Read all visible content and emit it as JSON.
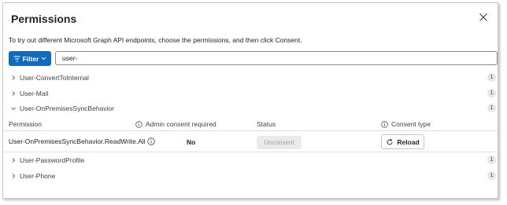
{
  "dialog": {
    "title": "Permissions",
    "subtitle": "To try out different Microsoft Graph API endpoints, choose the permissions, and then click Consent."
  },
  "filter": {
    "label": "Filter"
  },
  "search": {
    "value": "user-"
  },
  "groups": [
    {
      "name": "User-ConvertToInternal",
      "count": "1",
      "expanded": false
    },
    {
      "name": "User-Mail",
      "count": "1",
      "expanded": false
    },
    {
      "name": "User-OnPremisesSyncBehavior",
      "count": "1",
      "expanded": true
    },
    {
      "name": "User-PasswordProfile",
      "count": "1",
      "expanded": false
    },
    {
      "name": "User-Phone",
      "count": "1",
      "expanded": false
    }
  ],
  "table": {
    "headers": {
      "permission": "Permission",
      "admin_consent": "Admin consent required",
      "status": "Status",
      "consent_type": "Consent type"
    },
    "row": {
      "permission": "User-OnPremisesSyncBehavior.ReadWrite.All",
      "admin_consent": "No",
      "status_button": "Unconsent",
      "consent_button": "Reload"
    }
  },
  "colors": {
    "accent": "#0f6cbd",
    "disabled_bg": "#eaeaea"
  },
  "icons": {
    "close": "close-icon",
    "filter": "filter-lines-icon",
    "chevron_down": "chevron-down-icon",
    "chevron_right": "chevron-right-icon",
    "info": "info-icon",
    "reload": "reload-icon"
  }
}
